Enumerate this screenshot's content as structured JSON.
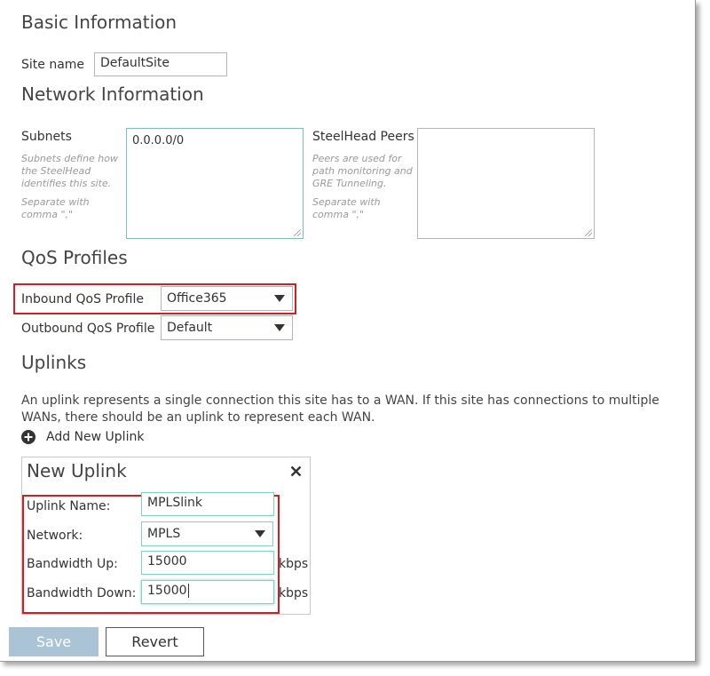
{
  "basic": {
    "title": "Basic Information",
    "site_name_label": "Site name",
    "site_name_value": "DefaultSite"
  },
  "network": {
    "title": "Network Information",
    "subnets_label": "Subnets",
    "subnets_hint1": "Subnets define how the SteelHead identifies this site.",
    "subnets_hint2": "Separate with comma \",\"",
    "subnets_value": "0.0.0.0/0",
    "peers_label": "SteelHead Peers",
    "peers_hint1": "Peers are used for path monitoring and GRE Tunneling.",
    "peers_hint2": "Separate with comma \",\"",
    "peers_value": ""
  },
  "qos": {
    "title": "QoS Profiles",
    "inbound_label": "Inbound QoS Profile",
    "inbound_value": "Office365",
    "outbound_label": "Outbound QoS Profile",
    "outbound_value": "Default"
  },
  "uplinks": {
    "title": "Uplinks",
    "description": "An uplink represents a single connection this site has to a WAN. If this site has connections to multiple WANs, there should be an uplink to represent each WAN.",
    "add_label": "Add New Uplink"
  },
  "new_uplink": {
    "title": "New Uplink",
    "name_label": "Uplink Name:",
    "name_value": "MPLSlink",
    "network_label": "Network:",
    "network_value": "MPLS",
    "bw_up_label": "Bandwidth Up:",
    "bw_up_value": "15000",
    "bw_up_unit": "kbps",
    "bw_down_label": "Bandwidth Down:",
    "bw_down_value": "15000",
    "bw_down_unit": "kbps"
  },
  "actions": {
    "save_label": "Save",
    "revert_label": "Revert"
  },
  "colors": {
    "highlight": "#d21f26",
    "focus_border": "#7fd3c0",
    "save_button": "#aac4d6"
  }
}
